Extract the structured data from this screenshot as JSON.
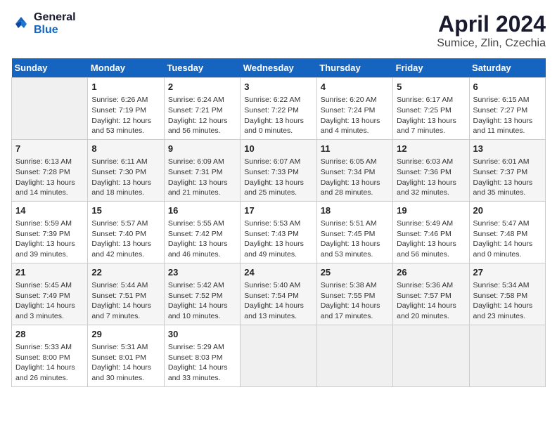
{
  "header": {
    "logo_line1": "General",
    "logo_line2": "Blue",
    "month_title": "April 2024",
    "location": "Sumice, Zlin, Czechia"
  },
  "weekdays": [
    "Sunday",
    "Monday",
    "Tuesday",
    "Wednesday",
    "Thursday",
    "Friday",
    "Saturday"
  ],
  "weeks": [
    [
      {
        "day": "",
        "info": ""
      },
      {
        "day": "1",
        "info": "Sunrise: 6:26 AM\nSunset: 7:19 PM\nDaylight: 12 hours\nand 53 minutes."
      },
      {
        "day": "2",
        "info": "Sunrise: 6:24 AM\nSunset: 7:21 PM\nDaylight: 12 hours\nand 56 minutes."
      },
      {
        "day": "3",
        "info": "Sunrise: 6:22 AM\nSunset: 7:22 PM\nDaylight: 13 hours\nand 0 minutes."
      },
      {
        "day": "4",
        "info": "Sunrise: 6:20 AM\nSunset: 7:24 PM\nDaylight: 13 hours\nand 4 minutes."
      },
      {
        "day": "5",
        "info": "Sunrise: 6:17 AM\nSunset: 7:25 PM\nDaylight: 13 hours\nand 7 minutes."
      },
      {
        "day": "6",
        "info": "Sunrise: 6:15 AM\nSunset: 7:27 PM\nDaylight: 13 hours\nand 11 minutes."
      }
    ],
    [
      {
        "day": "7",
        "info": "Sunrise: 6:13 AM\nSunset: 7:28 PM\nDaylight: 13 hours\nand 14 minutes."
      },
      {
        "day": "8",
        "info": "Sunrise: 6:11 AM\nSunset: 7:30 PM\nDaylight: 13 hours\nand 18 minutes."
      },
      {
        "day": "9",
        "info": "Sunrise: 6:09 AM\nSunset: 7:31 PM\nDaylight: 13 hours\nand 21 minutes."
      },
      {
        "day": "10",
        "info": "Sunrise: 6:07 AM\nSunset: 7:33 PM\nDaylight: 13 hours\nand 25 minutes."
      },
      {
        "day": "11",
        "info": "Sunrise: 6:05 AM\nSunset: 7:34 PM\nDaylight: 13 hours\nand 28 minutes."
      },
      {
        "day": "12",
        "info": "Sunrise: 6:03 AM\nSunset: 7:36 PM\nDaylight: 13 hours\nand 32 minutes."
      },
      {
        "day": "13",
        "info": "Sunrise: 6:01 AM\nSunset: 7:37 PM\nDaylight: 13 hours\nand 35 minutes."
      }
    ],
    [
      {
        "day": "14",
        "info": "Sunrise: 5:59 AM\nSunset: 7:39 PM\nDaylight: 13 hours\nand 39 minutes."
      },
      {
        "day": "15",
        "info": "Sunrise: 5:57 AM\nSunset: 7:40 PM\nDaylight: 13 hours\nand 42 minutes."
      },
      {
        "day": "16",
        "info": "Sunrise: 5:55 AM\nSunset: 7:42 PM\nDaylight: 13 hours\nand 46 minutes."
      },
      {
        "day": "17",
        "info": "Sunrise: 5:53 AM\nSunset: 7:43 PM\nDaylight: 13 hours\nand 49 minutes."
      },
      {
        "day": "18",
        "info": "Sunrise: 5:51 AM\nSunset: 7:45 PM\nDaylight: 13 hours\nand 53 minutes."
      },
      {
        "day": "19",
        "info": "Sunrise: 5:49 AM\nSunset: 7:46 PM\nDaylight: 13 hours\nand 56 minutes."
      },
      {
        "day": "20",
        "info": "Sunrise: 5:47 AM\nSunset: 7:48 PM\nDaylight: 14 hours\nand 0 minutes."
      }
    ],
    [
      {
        "day": "21",
        "info": "Sunrise: 5:45 AM\nSunset: 7:49 PM\nDaylight: 14 hours\nand 3 minutes."
      },
      {
        "day": "22",
        "info": "Sunrise: 5:44 AM\nSunset: 7:51 PM\nDaylight: 14 hours\nand 7 minutes."
      },
      {
        "day": "23",
        "info": "Sunrise: 5:42 AM\nSunset: 7:52 PM\nDaylight: 14 hours\nand 10 minutes."
      },
      {
        "day": "24",
        "info": "Sunrise: 5:40 AM\nSunset: 7:54 PM\nDaylight: 14 hours\nand 13 minutes."
      },
      {
        "day": "25",
        "info": "Sunrise: 5:38 AM\nSunset: 7:55 PM\nDaylight: 14 hours\nand 17 minutes."
      },
      {
        "day": "26",
        "info": "Sunrise: 5:36 AM\nSunset: 7:57 PM\nDaylight: 14 hours\nand 20 minutes."
      },
      {
        "day": "27",
        "info": "Sunrise: 5:34 AM\nSunset: 7:58 PM\nDaylight: 14 hours\nand 23 minutes."
      }
    ],
    [
      {
        "day": "28",
        "info": "Sunrise: 5:33 AM\nSunset: 8:00 PM\nDaylight: 14 hours\nand 26 minutes."
      },
      {
        "day": "29",
        "info": "Sunrise: 5:31 AM\nSunset: 8:01 PM\nDaylight: 14 hours\nand 30 minutes."
      },
      {
        "day": "30",
        "info": "Sunrise: 5:29 AM\nSunset: 8:03 PM\nDaylight: 14 hours\nand 33 minutes."
      },
      {
        "day": "",
        "info": ""
      },
      {
        "day": "",
        "info": ""
      },
      {
        "day": "",
        "info": ""
      },
      {
        "day": "",
        "info": ""
      }
    ]
  ]
}
